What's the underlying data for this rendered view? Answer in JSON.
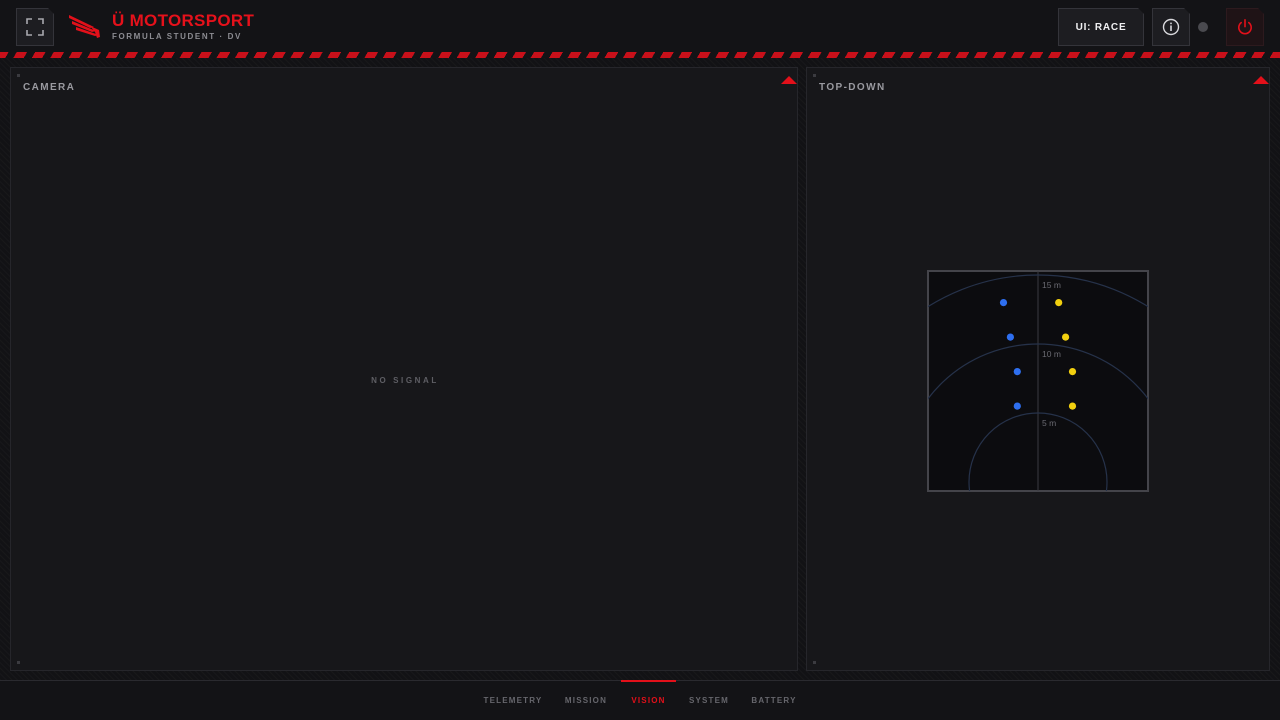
{
  "header": {
    "brand_title": "Ü MOTORSPORT",
    "brand_subtitle": "FORMULA STUDENT · DV",
    "ui_mode_label": "UI: RACE",
    "icons": {
      "fullscreen": "fullscreen-icon",
      "logo": "logo-icon",
      "info": "info-icon",
      "power": "power-icon"
    },
    "status": "inactive"
  },
  "camera_panel": {
    "title": "CAMERA",
    "placeholder": "NO SIGNAL"
  },
  "topdown_panel": {
    "title": "TOP-DOWN",
    "range_labels": [
      "15 m",
      "10 m",
      "5 m"
    ],
    "range_rings_m": [
      15,
      10,
      5
    ],
    "cones": {
      "blue": [
        {
          "x_m": -2.5,
          "y_m": 13.0
        },
        {
          "x_m": -2.0,
          "y_m": 10.5
        },
        {
          "x_m": -1.5,
          "y_m": 8.0
        },
        {
          "x_m": -1.5,
          "y_m": 5.5
        }
      ],
      "yellow": [
        {
          "x_m": 1.5,
          "y_m": 13.0
        },
        {
          "x_m": 2.0,
          "y_m": 10.5
        },
        {
          "x_m": 2.5,
          "y_m": 8.0
        },
        {
          "x_m": 2.5,
          "y_m": 5.5
        }
      ]
    }
  },
  "nav": {
    "tabs": [
      {
        "label": "TELEMETRY",
        "active": false
      },
      {
        "label": "MISSION",
        "active": false
      },
      {
        "label": "VISION",
        "active": true
      },
      {
        "label": "SYSTEM",
        "active": false
      },
      {
        "label": "BATTERY",
        "active": false
      }
    ]
  },
  "colors": {
    "accent": "#e3101a",
    "cone_blue": "#2e6ff0",
    "cone_yellow": "#f2d00f",
    "background": "#131316",
    "panel": "#17171a"
  }
}
